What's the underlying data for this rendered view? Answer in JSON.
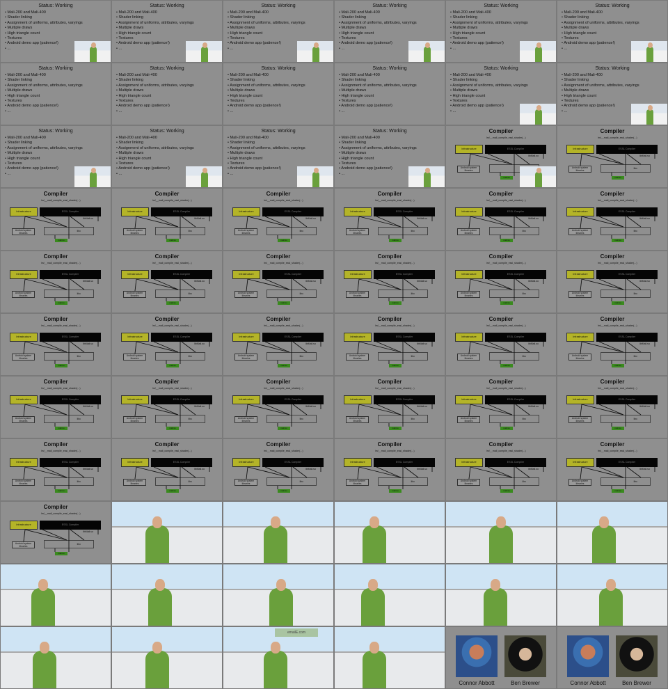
{
  "status_slide": {
    "title": "Status: Working",
    "items": [
      "Mali-200 and Mali-400",
      "Shader linking",
      "Assignment of uniforms, attributes, varyings",
      "Multiple draws",
      "High triangle count",
      "Textures",
      "Android demo app (patience!)",
      "..."
    ]
  },
  "compiler_slide": {
    "title": "Compiler",
    "note": "lm/__mali_compile_essl_shader(...)",
    "infrastructure": "Infrastructure",
    "block": "ESSL Compiler",
    "so_label": "libMali.so",
    "android": "Android system libraries",
    "libs": "libc",
    "green": "mali.ko"
  },
  "badge": "emailE.com",
  "credits": {
    "name_a": "Connor Abbott",
    "name_b": "Ben Brewer"
  },
  "tiles": [
    "status-inset",
    "status-inset",
    "status-inset",
    "status-inset",
    "status-inset",
    "status-inset",
    "status",
    "status",
    "status",
    "status",
    "status-inset",
    "status-inset",
    "status-inset",
    "status-inset",
    "status-inset",
    "status-inset",
    "compiler-inset",
    "compiler",
    "compiler",
    "compiler",
    "compiler",
    "compiler",
    "compiler",
    "compiler",
    "compiler",
    "compiler",
    "compiler",
    "compiler",
    "compiler",
    "compiler",
    "compiler",
    "compiler",
    "compiler",
    "compiler",
    "compiler",
    "compiler",
    "compiler",
    "compiler",
    "compiler",
    "compiler",
    "compiler",
    "compiler",
    "compiler",
    "compiler",
    "compiler",
    "compiler",
    "compiler",
    "compiler",
    "compiler",
    "video",
    "video",
    "video",
    "video",
    "video",
    "video",
    "video",
    "video",
    "video",
    "video",
    "video",
    "video",
    "video",
    "video-badge",
    "video",
    "credits",
    "credits"
  ]
}
